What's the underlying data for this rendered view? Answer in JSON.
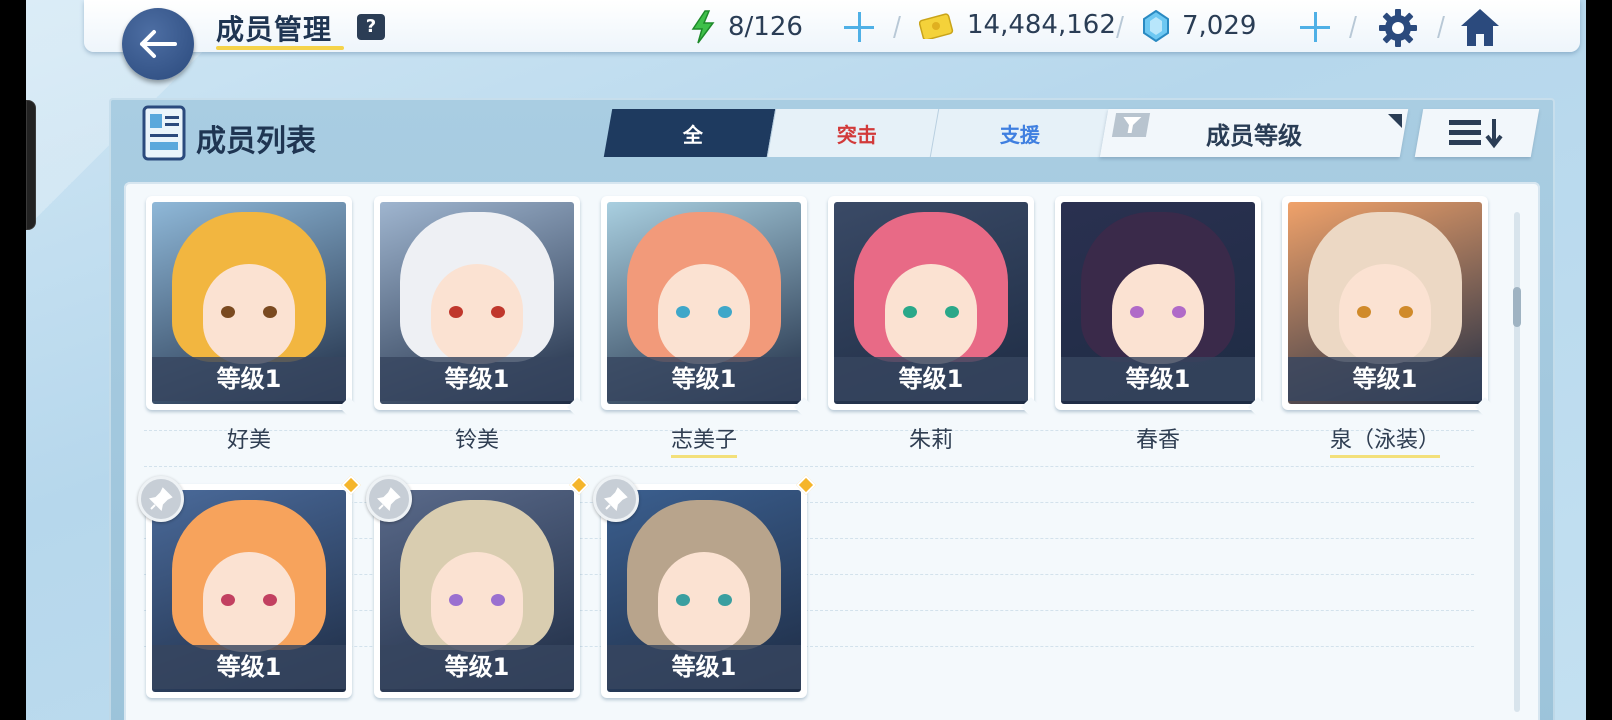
{
  "header": {
    "title": "成员管理",
    "help": "?",
    "ap": "8/126",
    "credits": "14,484,162",
    "gems": "7,029"
  },
  "panel": {
    "title": "成员列表",
    "tabs": [
      {
        "label": "全",
        "active": true,
        "color": "#ffffff"
      },
      {
        "label": "突击",
        "active": false,
        "color": "#d23a3a"
      },
      {
        "label": "支援",
        "active": false,
        "color": "#3f7fe0"
      }
    ],
    "sort_label": "成员等级"
  },
  "members": [
    {
      "name": "好美",
      "level": "等级1",
      "hair": "#f2b640",
      "eye": "#7a4a20",
      "bg": "#8fb8d8"
    },
    {
      "name": "铃美",
      "level": "等级1",
      "hair": "#eef0f4",
      "eye": "#c0372c",
      "bg": "#9fb5cf"
    },
    {
      "name": "志美子",
      "level": "等级1",
      "hair": "#f29a7a",
      "eye": "#3fa7c9",
      "bg": "#a9cfe0"
    },
    {
      "name": "朱莉",
      "level": "等级1",
      "hair": "#e86a86",
      "eye": "#2aa889",
      "bg": "#3a4a66"
    },
    {
      "name": "春香",
      "level": "等级1",
      "hair": "#3a2a4a",
      "eye": "#b06ac8",
      "bg": "#2a3050"
    },
    {
      "name": "泉（泳装）",
      "level": "等级1",
      "hair": "#ecd8c4",
      "eye": "#d08a2a",
      "bg": "#f0a26a"
    },
    {
      "name": "",
      "level": "等级1",
      "hair": "#f7a35c",
      "eye": "#c24060",
      "bg": "#4a6a9a"
    },
    {
      "name": "",
      "level": "等级1",
      "hair": "#d9cdb0",
      "eye": "#9a70d0",
      "bg": "#5a6a8a"
    },
    {
      "name": "",
      "level": "等级1",
      "hair": "#b8a48c",
      "eye": "#3a9fa0",
      "bg": "#3b5f8f"
    }
  ]
}
